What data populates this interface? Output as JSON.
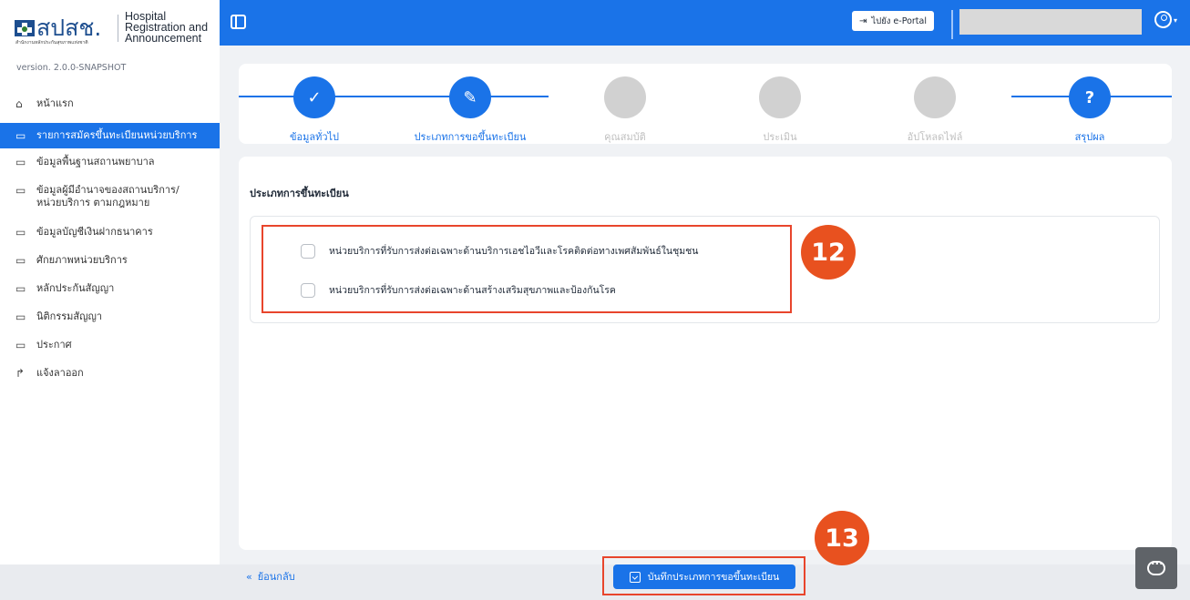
{
  "sidebar": {
    "logo_thai": "สปสช.",
    "logo_thai_sub": "สำนักงานหลักประกันสุขภาพแห่งชาติ",
    "logo_eng": "Hospital\nRegistration and\nAnnouncement",
    "version": "version. 2.0.0-SNAPSHOT",
    "items": [
      {
        "label": "หน้าแรก",
        "icon": "home-icon"
      },
      {
        "label": "รายการสมัครขึ้นทะเบียนหน่วยบริการ",
        "icon": "list-icon",
        "active": true
      },
      {
        "label": "ข้อมูลพื้นฐานสถานพยาบาล",
        "icon": "list-icon"
      },
      {
        "label": "ข้อมูลผู้มีอำนาจของสถานบริการ/\nหน่วยบริการ ตามกฎหมาย",
        "icon": "list-icon"
      },
      {
        "label": "ข้อมูลบัญชีเงินฝากธนาคาร",
        "icon": "list-icon"
      },
      {
        "label": "ศักยภาพหน่วยบริการ",
        "icon": "list-icon"
      },
      {
        "label": "หลักประกันสัญญา",
        "icon": "list-icon"
      },
      {
        "label": "นิติกรรมสัญญา",
        "icon": "list-icon"
      },
      {
        "label": "ประกาศ",
        "icon": "list-icon"
      },
      {
        "label": "แจ้งลาออก",
        "icon": "share-icon"
      }
    ]
  },
  "header": {
    "eportal_label": "ไปยัง e-Portal"
  },
  "stepper": {
    "steps": [
      {
        "label": "ข้อมูลทั่วไป",
        "state": "done",
        "glyph": "✓"
      },
      {
        "label": "ประเภทการขอขึ้นทะเบียน",
        "state": "current",
        "glyph": "✎"
      },
      {
        "label": "คุณสมบัติ",
        "state": "pending",
        "glyph": ""
      },
      {
        "label": "ประเมิน",
        "state": "pending",
        "glyph": ""
      },
      {
        "label": "อัปโหลดไฟล์",
        "state": "pending",
        "glyph": ""
      },
      {
        "label": "สรุปผล",
        "state": "summary",
        "glyph": "?"
      }
    ]
  },
  "form": {
    "title": "ประเภทการขึ้นทะเบียน",
    "options": [
      {
        "label": "หน่วยบริการที่รับการส่งต่อเฉพาะด้านบริการเอชไอวีและโรคติดต่อทางเพศสัมพันธ์ในชุมชน",
        "checked": false
      },
      {
        "label": "หน่วยบริการที่รับการส่งต่อเฉพาะด้านสร้างเสริมสุขภาพและป้องกันโรค",
        "checked": false
      }
    ]
  },
  "footer": {
    "back_label": "ย้อนกลับ",
    "save_label": "บันทึกประเภทการขอขึ้นทะเบียน"
  },
  "annotations": {
    "badge_12": "12",
    "badge_13": "13"
  },
  "colors": {
    "primary": "#1a73e8",
    "annotation": "#e8511f",
    "pending_step": "#d1d1d1"
  }
}
